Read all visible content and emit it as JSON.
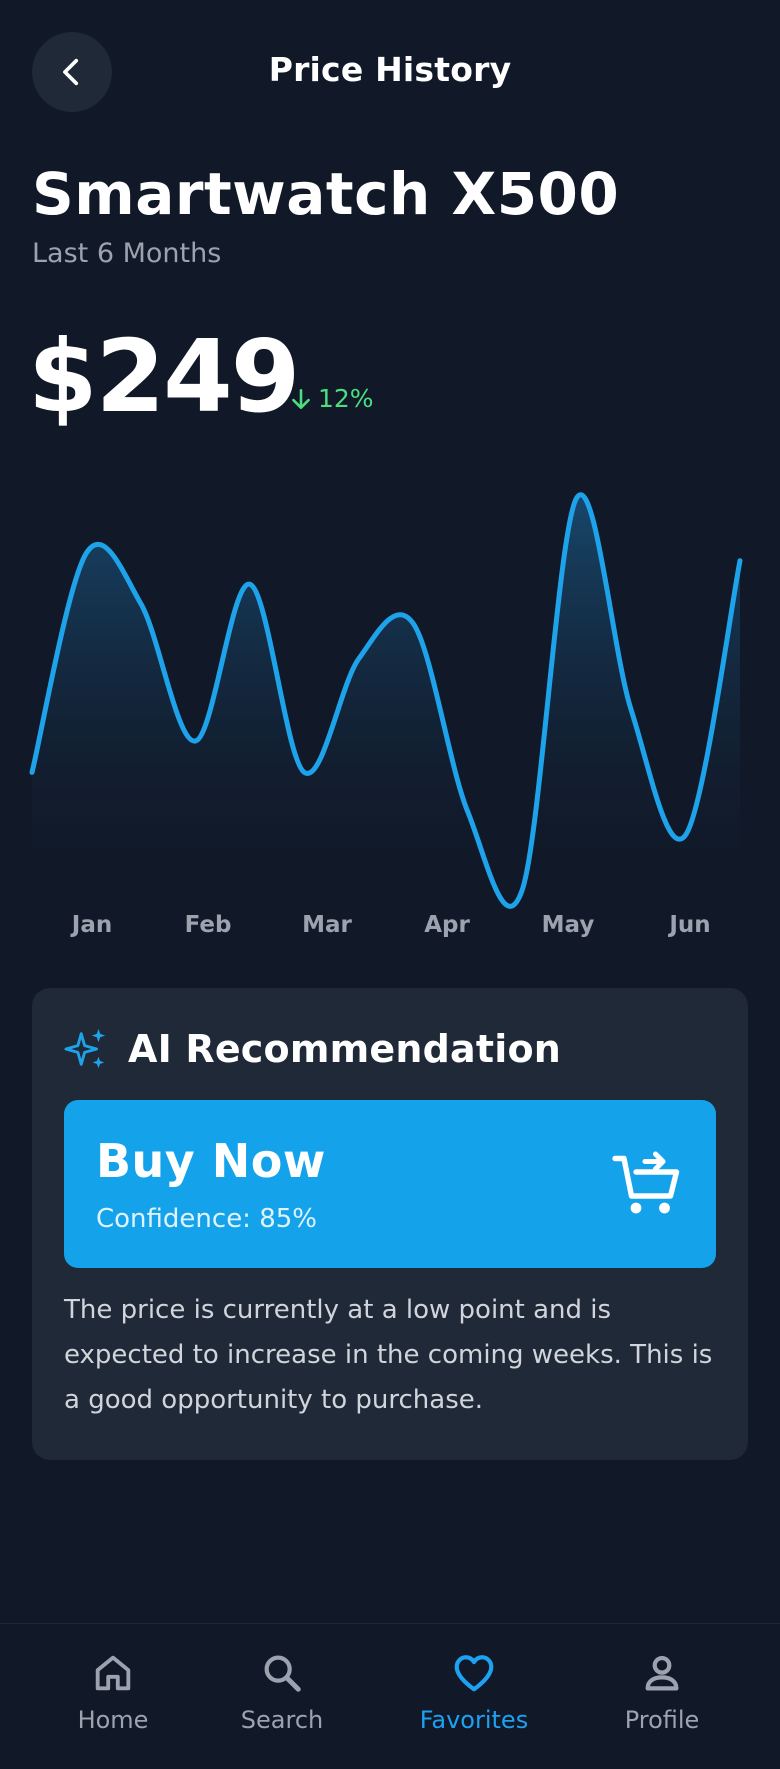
{
  "header": {
    "title": "Price History",
    "back_icon": "chevron-left-icon"
  },
  "product": {
    "name": "Smartwatch X500",
    "period": "Last 6 Months",
    "price": "$249",
    "change": "12%",
    "change_direction": "down",
    "change_color": "#4ade80"
  },
  "chart_data": {
    "type": "area",
    "categories": [
      "Jan",
      "Feb",
      "Mar",
      "Apr",
      "May",
      "Jun"
    ],
    "y_relative": [
      0.3,
      0.86,
      0.73,
      0.38,
      0.78,
      0.3,
      0.59,
      0.68,
      0.2,
      0.0,
      1.0,
      0.46,
      0.14,
      0.84
    ],
    "line_color": "#1ea3ea",
    "grid": false
  },
  "recommendation": {
    "title": "AI Recommendation",
    "icon": "sparkles-icon",
    "action": "Buy Now",
    "confidence": "Confidence: 85%",
    "action_icon": "cart-add-icon",
    "description": "The price is currently at a low point and is expected to increase in the coming weeks. This is a good opportunity to purchase.",
    "accent": "#14a3ea"
  },
  "nav": {
    "items": [
      {
        "label": "Home",
        "icon": "home-icon",
        "active": false
      },
      {
        "label": "Search",
        "icon": "search-icon",
        "active": false
      },
      {
        "label": "Favorites",
        "icon": "heart-icon",
        "active": true
      },
      {
        "label": "Profile",
        "icon": "user-icon",
        "active": false
      }
    ],
    "active_color": "#1da1f2"
  }
}
